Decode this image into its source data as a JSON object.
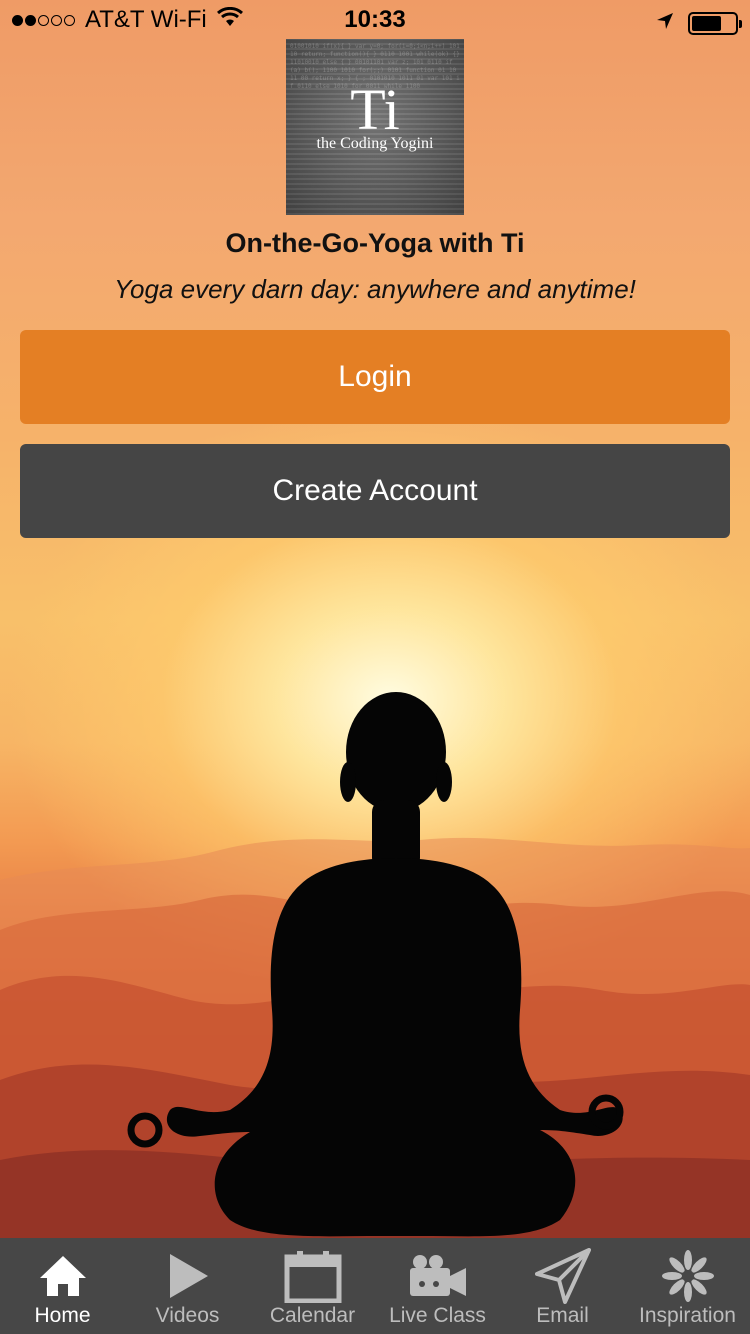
{
  "status_bar": {
    "carrier": "AT&T Wi-Fi",
    "time": "10:33",
    "signal_bars_filled": 2,
    "signal_bars_total": 5
  },
  "logo": {
    "mark": "Ti",
    "subtitle": "the Coding Yogini"
  },
  "header": {
    "title": "On-the-Go-Yoga with Ti",
    "tagline": "Yoga every darn day: anywhere and anytime!"
  },
  "buttons": {
    "login_label": "Login",
    "create_account_label": "Create Account",
    "login_color": "#e47f24",
    "create_color": "#454545"
  },
  "tabs": [
    {
      "label": "Home",
      "icon": "home-icon",
      "active": true
    },
    {
      "label": "Videos",
      "icon": "play-icon",
      "active": false
    },
    {
      "label": "Calendar",
      "icon": "calendar-icon",
      "active": false
    },
    {
      "label": "Live Class",
      "icon": "video-camera-icon",
      "active": false
    },
    {
      "label": "Email",
      "icon": "paper-plane-icon",
      "active": false
    },
    {
      "label": "Inspiration",
      "icon": "flower-icon",
      "active": false
    }
  ]
}
